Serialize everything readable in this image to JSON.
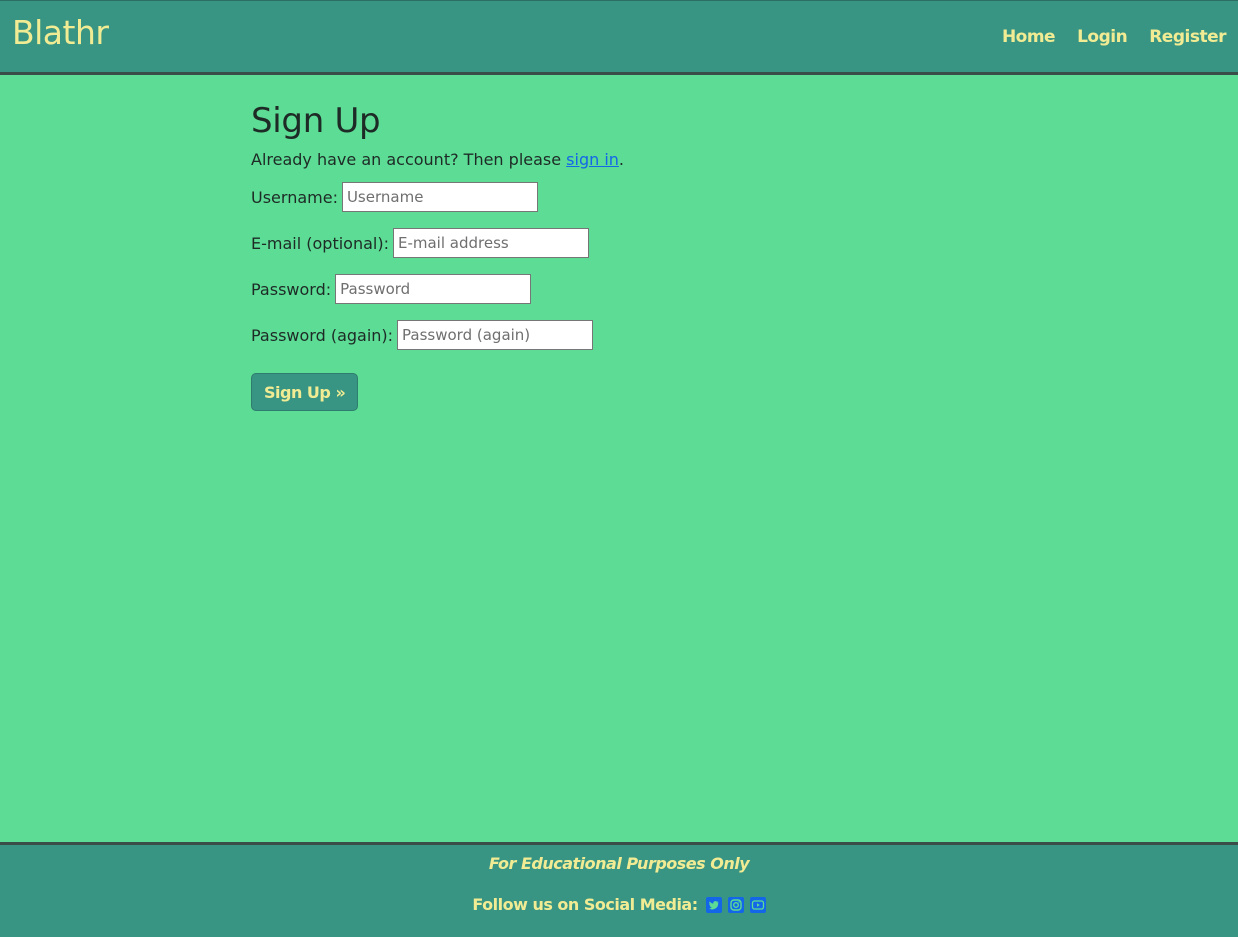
{
  "navbar": {
    "brand": "Blathr",
    "links": [
      {
        "label": "Home"
      },
      {
        "label": "Login"
      },
      {
        "label": "Register"
      }
    ]
  },
  "main": {
    "title": "Sign Up",
    "intro_text": "Already have an account? Then please ",
    "intro_link": "sign in",
    "intro_end": ".",
    "fields": [
      {
        "label": "Username:",
        "placeholder": "Username",
        "value": ""
      },
      {
        "label": "E-mail (optional):",
        "placeholder": "E-mail address",
        "value": ""
      },
      {
        "label": "Password:",
        "placeholder": "Password",
        "value": ""
      },
      {
        "label": "Password (again):",
        "placeholder": "Password (again)",
        "value": ""
      }
    ],
    "submit_label": "Sign Up »"
  },
  "footer": {
    "note": "For Educational Purposes Only",
    "social_label": "Follow us on Social Media:",
    "social_icons": [
      "twitter-icon",
      "instagram-icon",
      "youtube-icon"
    ]
  },
  "colors": {
    "page_background": "#5cdc94",
    "header_footer_background": "#389583",
    "accent_text": "#f1ec94",
    "link": "#1466e8",
    "social_icon": "#1466e8"
  }
}
